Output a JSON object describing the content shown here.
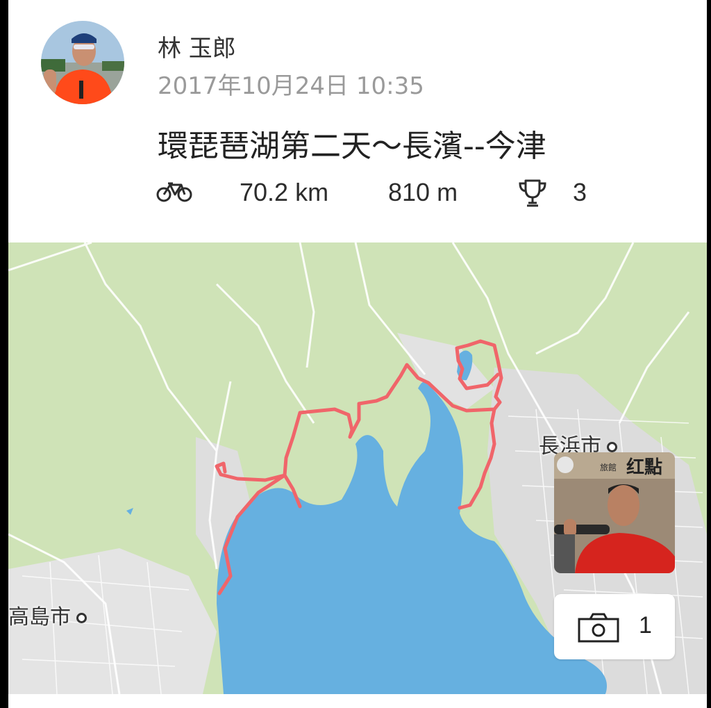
{
  "activity": {
    "athlete_name": "林 玉郎",
    "datetime": "2017年10月24日 10:35",
    "title": "環琵琶湖第二天～長濱--今津",
    "stats": {
      "activity_icon": "bicycle-icon",
      "distance": "70.2 km",
      "elevation": "810 m",
      "achievements_icon": "trophy-icon",
      "achievements": "3"
    }
  },
  "map": {
    "cities": [
      {
        "label": "長浜市"
      },
      {
        "label": "高島市"
      }
    ],
    "route_color": "#f0656a",
    "water_color": "#66b0e0",
    "land_color": "#cfe3b7"
  },
  "photos": {
    "thumbnail_sign": "红點",
    "thumbnail_sign_small": "旅館",
    "camera_icon": "camera-icon",
    "count": "1"
  }
}
